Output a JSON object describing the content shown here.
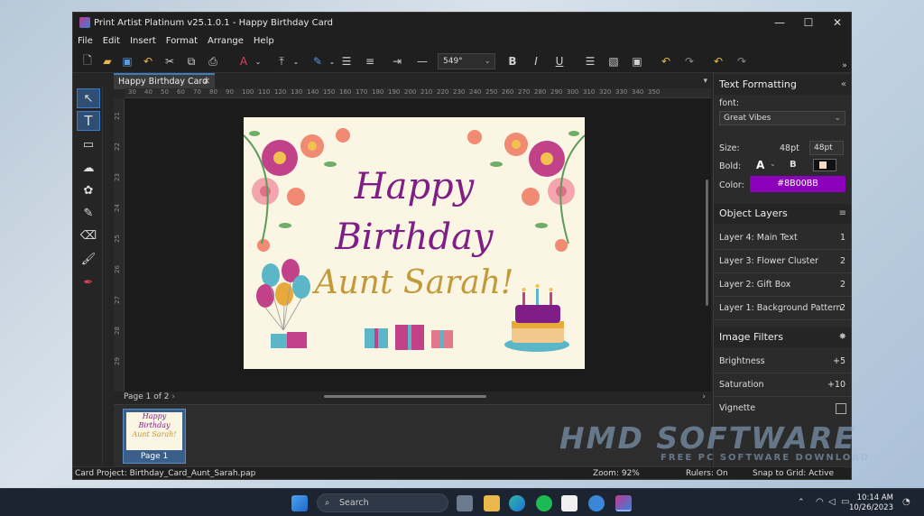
{
  "window": {
    "title": "Print Artist Platinum v25.1.0.1 - Happy Birthday Card"
  },
  "menu": [
    "File",
    "Edit",
    "Insert",
    "Format",
    "Arrange",
    "Help"
  ],
  "toolbar": {
    "font_size": "549°"
  },
  "document_tab": {
    "label": "Happy Birthday Card"
  },
  "ruler": {
    "h_ticks": [
      "30",
      "40",
      "50",
      "60",
      "70",
      "80",
      "90",
      "100",
      "110",
      "120",
      "130",
      "140",
      "150",
      "160",
      "170",
      "180",
      "190",
      "200",
      "210",
      "220",
      "230",
      "240",
      "250",
      "260",
      "270",
      "280",
      "290",
      "300",
      "310",
      "320",
      "330",
      "340",
      "350"
    ],
    "v_ticks": [
      "21",
      "22",
      "23",
      "24",
      "25",
      "26",
      "27",
      "28",
      "29"
    ]
  },
  "card": {
    "line1": "Happy",
    "line2": "Birthday",
    "line3": "Aunt Sarah!"
  },
  "pages": {
    "indicator": "Page 1 of 2",
    "thumb_label": "Page 1"
  },
  "panel": {
    "text_formatting": {
      "title": "Text Formatting",
      "font_label": "font:",
      "font_value": "Great Vibes",
      "size_label": "Size:",
      "size_value1": "48pt",
      "size_value2": "48pt",
      "bold_label": "Bold:",
      "bold_value": "A",
      "color_label": "Color:",
      "color_value": "#8B00BB"
    },
    "layers": {
      "title": "Object Layers",
      "items": [
        {
          "name": "Layer 4: Main Text",
          "num": "1"
        },
        {
          "name": "Layer 3: Flower Cluster",
          "num": "2"
        },
        {
          "name": "Layer 2: Gift Box",
          "num": "2"
        },
        {
          "name": "Layer 1: Background Pattern",
          "num": "2"
        }
      ]
    },
    "filters": {
      "title": "Image Filters",
      "brightness_label": "Brightness",
      "brightness_value": "+5",
      "saturation_label": "Saturation",
      "saturation_value": "+10",
      "vignette_label": "Vignette"
    }
  },
  "status": {
    "project": "Card Project: Birthday_Card_Aunt_Sarah.pap",
    "zoom": "Zoom: 92%",
    "rulers": "Rulers: On",
    "snap": "Snap to Grid: Active"
  },
  "taskbar": {
    "search_placeholder": "Search",
    "time": "10:14 AM",
    "date": "10/26/2023"
  },
  "watermark": {
    "line1": "HMD SOFTWARE",
    "line2": "FREE PC SOFTWARE DOWNLOAD"
  },
  "colors": {
    "accent": "#3d7bc4",
    "title_purple": "#7e1e86",
    "gold": "#c29a3a",
    "card_bg": "#fbf5e4",
    "swatch": "#8B00BB"
  }
}
